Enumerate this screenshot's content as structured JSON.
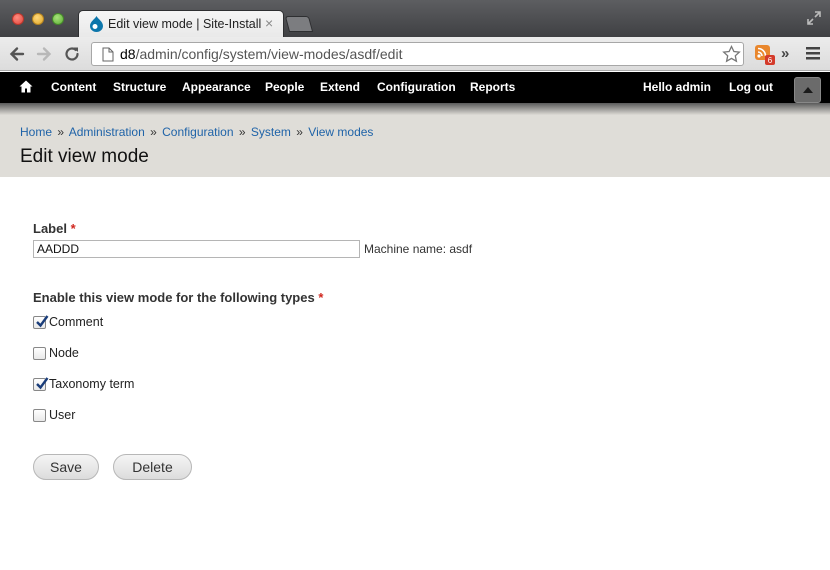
{
  "browser": {
    "tab_title": "Edit view mode | Site-Install",
    "tab_close": "×",
    "url_host": "d8",
    "url_path": "/admin/config/system/view-modes/asdf/edit",
    "more": "»"
  },
  "admin_toolbar": {
    "items": [
      "Content",
      "Structure",
      "Appearance",
      "People",
      "Extend",
      "Configuration",
      "Reports"
    ],
    "hello_prefix": "Hello ",
    "hello_user": "admin",
    "logout": "Log out"
  },
  "breadcrumb": {
    "items": [
      "Home",
      "Administration",
      "Configuration",
      "System",
      "View modes"
    ],
    "separator": "»"
  },
  "page_title": "Edit view mode",
  "form": {
    "label_title": "Label",
    "required_mark": "*",
    "label_value": "AADDD",
    "machine_name": "Machine name: asdf",
    "types_title": "Enable this view mode for the following types",
    "types": [
      {
        "label": "Comment",
        "checked": true
      },
      {
        "label": "Node",
        "checked": false
      },
      {
        "label": "Taxonomy term",
        "checked": true
      },
      {
        "label": "User",
        "checked": false
      }
    ],
    "save_label": "Save",
    "delete_label": "Delete"
  },
  "colors": {
    "link": "#1f63a8",
    "required": "#d0261e",
    "header_bg": "#dfddd8"
  }
}
